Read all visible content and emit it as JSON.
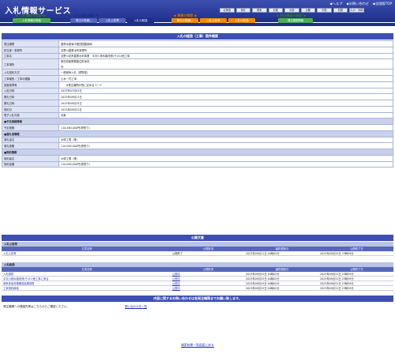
{
  "header": {
    "logo": "入札情報サービス",
    "top_links": [
      "◆ヘルプ",
      "◆お問い合わせ",
      "◆全国版TOP"
    ],
    "regions": [
      "北海道",
      "東北",
      "関東",
      "北陸",
      "中部",
      "近畿",
      "中国",
      "四国",
      "九州・沖縄",
      "",
      "",
      ""
    ],
    "nav_categories": [
      "◆ 工事の検索 ◆",
      "◆ 業務の検索 ◆",
      "◆ 発注機関の検索 ◆"
    ],
    "nav_prefix": "◆ 入札情報の検索 ◆",
    "nav_buttons": [
      "入札情報の検索",
      "発注の見通し",
      "入札公告等",
      "入札の経過",
      "発注の見通し",
      "入札公告等",
      "入札の経過",
      "発注機関情報"
    ]
  },
  "panel": {
    "title": "入札の経過（工事）案件概要",
    "rows": [
      {
        "k": "発注機関",
        "v": "農林水産省中国四国農政局"
      },
      {
        "k": "担当部・事務所",
        "v": "吉野川農業水利事業所"
      },
      {
        "k": "工事名",
        "v": "吉野川北岸農業水利事業　平次川排水路改修(その1)他工事"
      },
      {
        "k": "工事場所",
        "v": "徳島県板野郡藍住町地内",
        "v2": "外",
        "tall": true
      },
      {
        "k": "入札契約方式",
        "v": "一般競争入札（標準型）"
      },
      {
        "k": "工事種別／工事の種類",
        "v": "土木一式工事"
      },
      {
        "k": "調査基準等",
        "v": "　　※発注機関が別に定めるコード"
      },
      {
        "k": "公告日時",
        "v": "2023年07月03日"
      },
      {
        "k": "開札日時",
        "v": "2023年09月21日"
      },
      {
        "k": "開札日時",
        "v": "2023年09月25日"
      },
      {
        "k": "契約日",
        "v": "2023年09月22日"
      },
      {
        "k": "電子入札対象",
        "v": "対象"
      },
      {
        "sec": "■予定価格情報"
      },
      {
        "k": "予定価格",
        "v": "110,460,000円(税別り)"
      },
      {
        "sec": "■落札者情報"
      },
      {
        "k": "落札者名",
        "v": "大塚工業（株）"
      },
      {
        "k": "落札価格",
        "v": "110,000,000円(税別り)"
      },
      {
        "sec": "■契約情報"
      },
      {
        "k": "契約者名",
        "v": "大塚工業（株）"
      },
      {
        "k": "契約金額",
        "v": "110,000,000円(税別り)"
      }
    ]
  },
  "documents": {
    "title": "公開文書",
    "headers": [
      "文書名称",
      "公開状況",
      "最終更新日",
      "公開終了日"
    ],
    "groups": [
      {
        "name": "入札公告等",
        "rows": [
          [
            "入札公告等",
            "公開終了",
            "2023年09月21日 04時02分",
            "2023年09月25日 23時59分"
          ]
        ]
      },
      {
        "name": "入札経過",
        "rows": [
          [
            "入札調書",
            "公開中",
            "2023年09月25日 04時02分",
            "2023年09月31日 23時59分"
          ],
          [
            "平次川排水路改修(その1)他工事に係る",
            "公開中",
            "2023年09月25日 04時02分",
            "2023年09月31日 23時59分"
          ],
          [
            "競争参加資格確認結果調書",
            "公開中",
            "2023年09月25日 04時02分",
            "2023年09月31日 23時59分"
          ],
          [
            "工事契約締結",
            "公開中",
            "2023年09月25日 04時02分",
            "2023年09月31日 23時59分"
          ]
        ]
      }
    ]
  },
  "inquiry": {
    "bar": "内容に関するお問い合わせは各発注機関までお願い致します。",
    "text": "発注機関への連絡先等はこちらからご確認ください。",
    "link": "問い合わせ先一覧"
  },
  "back_link": "検索結果一覧画面に戻る",
  "colors": {
    "brand": "#1f2e8a",
    "accent": "#3d4fb0",
    "label_bg": "#dfe4f4"
  }
}
